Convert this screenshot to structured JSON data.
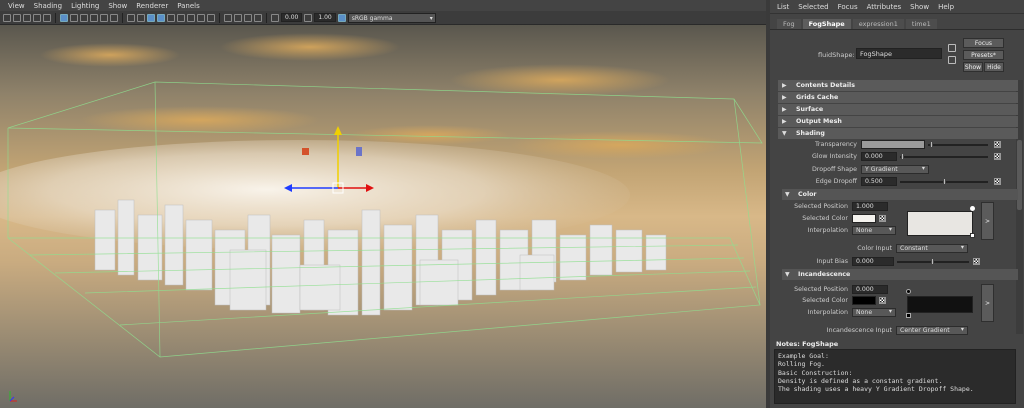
{
  "viewport": {
    "menu": [
      "View",
      "Shading",
      "Lighting",
      "Show",
      "Renderer",
      "Panels"
    ],
    "toolbar": {
      "field1": "0.00",
      "field2": "1.00",
      "color_space": "sRGB gamma"
    }
  },
  "panel": {
    "menu": [
      "List",
      "Selected",
      "Focus",
      "Attributes",
      "Show",
      "Help"
    ],
    "tabs": [
      "Fog",
      "FogShape",
      "expression1",
      "time1"
    ],
    "node": {
      "label": "fluidShape:",
      "value": "FogShape"
    },
    "buttons": {
      "focus": "Focus",
      "presets": "Presets*",
      "show": "Show",
      "hide": "Hide"
    },
    "sections": {
      "contents_details": "Contents Details",
      "grids_cache": "Grids Cache",
      "surface": "Surface",
      "output_mesh": "Output Mesh",
      "shading": "Shading"
    },
    "shading": {
      "transparency": {
        "label": "Transparency",
        "level": 0.55
      },
      "glow": {
        "label": "Glow Intensity",
        "value": "0.000",
        "level": 0.0
      },
      "dropoff_shape": {
        "label": "Dropoff Shape",
        "value": "Y Gradient"
      },
      "edge_dropoff": {
        "label": "Edge Dropoff",
        "value": "0.500",
        "level": 0.5
      }
    },
    "color": {
      "title": "Color",
      "selected_position": {
        "label": "Selected Position",
        "value": "1.000"
      },
      "selected_color": {
        "label": "Selected Color"
      },
      "interpolation": {
        "label": "Interpolation",
        "value": "None"
      },
      "color_input": {
        "label": "Color Input",
        "value": "Constant"
      },
      "input_bias": {
        "label": "Input Bias",
        "value": "0.000",
        "level": 0.5
      },
      "swatch": "#e8e6e2",
      "expand": ">"
    },
    "incandescence": {
      "title": "Incandescence",
      "selected_position": {
        "label": "Selected Position",
        "value": "0.000"
      },
      "selected_color": {
        "label": "Selected Color"
      },
      "interpolation": {
        "label": "Interpolation",
        "value": "None"
      },
      "input": {
        "label": "Incandescence Input",
        "value": "Center Gradient"
      },
      "swatch": "#111111",
      "expand": ">"
    },
    "notes": {
      "title": "Notes: FogShape",
      "lines": [
        "Example Goal:",
        "Rolling Fog.",
        "",
        "Basic Construction:",
        "Density is defined as a constant gradient.",
        "The shading uses a heavy Y Gradient Dropoff Shape."
      ]
    }
  }
}
